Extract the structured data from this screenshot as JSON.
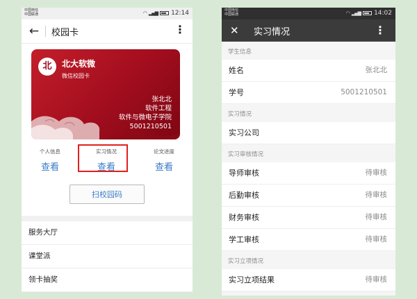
{
  "left_phone": {
    "status": {
      "carrier_line1": "中国电信",
      "carrier_line2": "中国联通",
      "time": "12:14"
    },
    "header": {
      "title": "校园卡"
    },
    "card": {
      "school_name": "北大软微",
      "card_type": "微信校园卡",
      "holder_name": "张北北",
      "major": "软件工程",
      "school_department": "软件与微电子学院",
      "student_id": "5001210501"
    },
    "quick_actions": [
      {
        "label": "个人信息",
        "action": "查看"
      },
      {
        "label": "实习情况",
        "action": "查看"
      },
      {
        "label": "论文进度",
        "action": "查看"
      }
    ],
    "scan_button": "扫校园码",
    "menu": [
      "服务大厅",
      "课堂派",
      "领卡抽奖"
    ]
  },
  "right_phone": {
    "status": {
      "carrier_line1": "中国电信",
      "carrier_line2": "中国联通",
      "time": "14:02"
    },
    "header": {
      "title": "实习情况"
    },
    "sections": {
      "student_info": "学生信息",
      "internship_info": "实习情况",
      "review_info": "实习审核情况",
      "project_info": "实习立项情况"
    },
    "student_rows": [
      {
        "label": "姓名",
        "value": "张北北"
      },
      {
        "label": "学号",
        "value": "5001210501"
      }
    ],
    "internship_rows": [
      {
        "label": "实习公司",
        "value": ""
      }
    ],
    "review_rows": [
      {
        "label": "导师审核",
        "value": "待审核"
      },
      {
        "label": "后勤审核",
        "value": "待审核"
      },
      {
        "label": "财务审核",
        "value": "待审核"
      },
      {
        "label": "学工审核",
        "value": "待审核"
      }
    ],
    "project_rows": [
      {
        "label": "实习立项结果",
        "value": "待审核"
      }
    ]
  },
  "colors": {
    "background": "#d8ead6",
    "card_red": "#a10d1e",
    "link_blue": "#3a7bc8",
    "highlight_red": "#e0201f",
    "dark_header": "#3b3b3b"
  }
}
